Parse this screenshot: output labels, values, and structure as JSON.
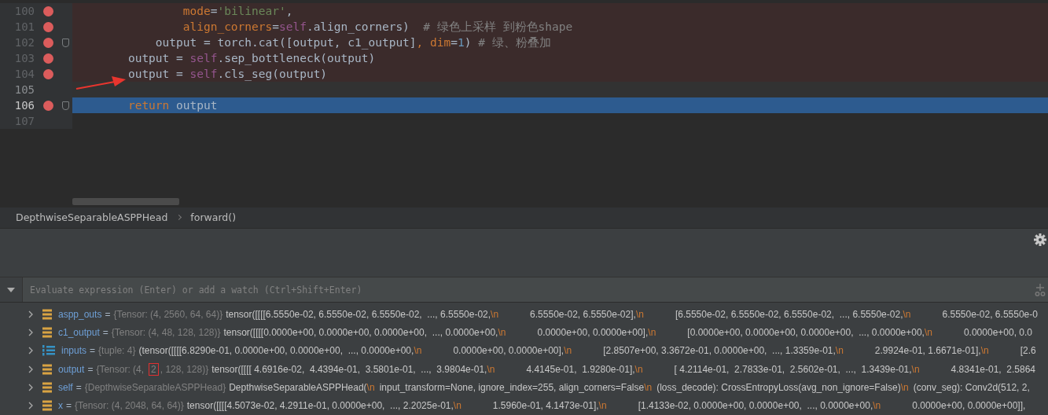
{
  "editor": {
    "lines": [
      {
        "number": "100",
        "breakpoint": true,
        "fold": false,
        "current": false,
        "caret": false,
        "tokens": [
          {
            "kind": "param",
            "text": "            mode"
          },
          {
            "kind": "plain",
            "text": "="
          },
          {
            "kind": "string",
            "text": "'bilinear'"
          },
          {
            "kind": "plain",
            "text": ","
          }
        ]
      },
      {
        "number": "101",
        "breakpoint": true,
        "fold": false,
        "current": false,
        "caret": false,
        "tokens": [
          {
            "kind": "param",
            "text": "            align_corners"
          },
          {
            "kind": "plain",
            "text": "="
          },
          {
            "kind": "self",
            "text": "self"
          },
          {
            "kind": "plain",
            "text": ".align_corners)  "
          },
          {
            "kind": "comment",
            "text": "# 绿色上采样 到粉色shape"
          }
        ]
      },
      {
        "number": "102",
        "breakpoint": true,
        "fold": true,
        "current": false,
        "caret": false,
        "tokens": [
          {
            "kind": "plain",
            "text": "        output = torch.cat([output, c1_output]"
          },
          {
            "kind": "keyword",
            "text": ", "
          },
          {
            "kind": "param",
            "text": "dim"
          },
          {
            "kind": "plain",
            "text": "="
          },
          {
            "kind": "number",
            "text": "1"
          },
          {
            "kind": "plain",
            "text": ") "
          },
          {
            "kind": "comment",
            "text": "# 绿、粉叠加"
          }
        ]
      },
      {
        "number": "103",
        "breakpoint": true,
        "fold": false,
        "current": false,
        "caret": false,
        "tokens": [
          {
            "kind": "plain",
            "text": "    output = "
          },
          {
            "kind": "self",
            "text": "self"
          },
          {
            "kind": "plain",
            "text": ".sep_bottleneck(output)"
          }
        ]
      },
      {
        "number": "104",
        "breakpoint": true,
        "fold": false,
        "current": false,
        "caret": false,
        "tokens": [
          {
            "kind": "plain",
            "text": "    output = "
          },
          {
            "kind": "self",
            "text": "self"
          },
          {
            "kind": "plain",
            "text": ".cls_seg(output)"
          }
        ]
      },
      {
        "number": "105",
        "breakpoint": false,
        "fold": false,
        "current": false,
        "caret": true
      },
      {
        "number": "106",
        "breakpoint": true,
        "fold": true,
        "current": true,
        "caret": false,
        "tokens": [
          {
            "kind": "keyword",
            "text": "    return"
          },
          {
            "kind": "plain",
            "text": " output"
          }
        ]
      },
      {
        "number": "107",
        "breakpoint": false,
        "fold": false,
        "current": false,
        "caret": false
      }
    ]
  },
  "breadcrumbs": [
    "DepthwiseSeparableASPPHead",
    "forward()"
  ],
  "watch": {
    "placeholder": "Evaluate expression (Enter) or add a watch (Ctrl+Shift+Enter)"
  },
  "variables": [
    {
      "kind": "tensor",
      "name": "aspp_outs",
      "equals": "=",
      "type": [
        {
          "text": "{Tensor: (4, 2560, 64, 64)}",
          "boxed": false
        }
      ],
      "parts": [
        {
          "kind": "value",
          "text": "tensor([[[[6.5550e-02, 6.5550e-02, 6.5550e-02,  ..., 6.5550e-02,"
        },
        {
          "kind": "escape",
          "text": "\\n"
        },
        {
          "kind": "value",
          "text": "6.5550e-02, 6.5550e-02],"
        },
        {
          "kind": "escape",
          "text": "\\n"
        },
        {
          "kind": "value",
          "text": "[6.5550e-02, 6.5550e-02, 6.5550e-02,  ..., 6.5550e-02,"
        },
        {
          "kind": "escape",
          "text": "\\n"
        },
        {
          "kind": "value",
          "text": "6.5550e-02, 6.5550e-0"
        }
      ]
    },
    {
      "kind": "tensor",
      "name": "c1_output",
      "equals": "=",
      "type": [
        {
          "text": "{Tensor: (4, 48, 128, 128)}",
          "boxed": false
        }
      ],
      "parts": [
        {
          "kind": "value",
          "text": "tensor([[[[0.0000e+00, 0.0000e+00, 0.0000e+00,  ..., 0.0000e+00,"
        },
        {
          "kind": "escape",
          "text": "\\n"
        },
        {
          "kind": "value",
          "text": "0.0000e+00, 0.0000e+00],"
        },
        {
          "kind": "escape",
          "text": "\\n"
        },
        {
          "kind": "value",
          "text": "[0.0000e+00, 0.0000e+00, 0.0000e+00,  ..., 0.0000e+00,"
        },
        {
          "kind": "escape",
          "text": "\\n"
        },
        {
          "kind": "value",
          "text": "0.0000e+00, 0.0"
        }
      ]
    },
    {
      "kind": "tuple",
      "name": "inputs",
      "equals": "=",
      "type": [
        {
          "text": "{tuple: 4}",
          "boxed": false
        }
      ],
      "parts": [
        {
          "kind": "value",
          "text": "(tensor([[[[6.8290e-01, 0.0000e+00, 0.0000e+00,  ..., 0.0000e+00,"
        },
        {
          "kind": "escape",
          "text": "\\n"
        },
        {
          "kind": "value",
          "text": "0.0000e+00, 0.0000e+00],"
        },
        {
          "kind": "escape",
          "text": "\\n"
        },
        {
          "kind": "value",
          "text": "[2.8507e+00, 3.3672e-01, 0.0000e+00,  ..., 1.3359e-01,"
        },
        {
          "kind": "escape",
          "text": "\\n"
        },
        {
          "kind": "value",
          "text": "2.9924e-01, 1.6671e-01],"
        },
        {
          "kind": "escape",
          "text": "\\n"
        },
        {
          "kind": "value",
          "text": "[2.6"
        }
      ]
    },
    {
      "kind": "tensor",
      "name": "output",
      "equals": "=",
      "type": [
        {
          "text": "{Tensor: (4,",
          "boxed": false
        },
        {
          "text": "2",
          "boxed": true
        },
        {
          "text": ", 128, 128)}",
          "boxed": false
        }
      ],
      "parts": [
        {
          "kind": "value",
          "text": "tensor([[[[ 4.6916e-02,  4.4394e-01,  3.5801e-01,  ...,  3.9804e-01,"
        },
        {
          "kind": "escape",
          "text": "\\n"
        },
        {
          "kind": "value",
          "text": "4.4145e-01,  1.9280e-01],"
        },
        {
          "kind": "escape",
          "text": "\\n"
        },
        {
          "kind": "value",
          "text": "[ 4.2114e-01,  2.7833e-01,  2.5602e-01,  ...,  1.3439e-01,"
        },
        {
          "kind": "escape",
          "text": "\\n"
        },
        {
          "kind": "value",
          "text": "4.8341e-01,  2.5864"
        }
      ]
    },
    {
      "kind": "object",
      "name": "self",
      "equals": "=",
      "type": [
        {
          "text": "{DepthwiseSeparableASPPHead}",
          "boxed": false
        }
      ],
      "parts": [
        {
          "kind": "value",
          "text": "DepthwiseSeparableASPPHead("
        },
        {
          "kind": "escape",
          "text": "\\n"
        },
        {
          "kind": "value",
          "text": "input_transform=None, ignore_index=255, align_corners=False"
        },
        {
          "kind": "escape",
          "text": "\\n"
        },
        {
          "kind": "value",
          "text": "(loss_decode): CrossEntropyLoss(avg_non_ignore=False)"
        },
        {
          "kind": "escape",
          "text": "\\n"
        },
        {
          "kind": "value",
          "text": "(conv_seg): Conv2d(512, 2,"
        }
      ]
    },
    {
      "kind": "tensor",
      "name": "x",
      "equals": "=",
      "type": [
        {
          "text": "{Tensor: (4, 2048, 64, 64)}",
          "boxed": false
        }
      ],
      "parts": [
        {
          "kind": "value",
          "text": "tensor([[[[4.5073e-02, 4.2911e-01, 0.0000e+00,  ..., 2.2025e-01,"
        },
        {
          "kind": "escape",
          "text": "\\n"
        },
        {
          "kind": "value",
          "text": "1.5960e-01, 4.1473e-01],"
        },
        {
          "kind": "escape",
          "text": "\\n"
        },
        {
          "kind": "value",
          "text": "[1.4133e-02, 0.0000e+00, 0.0000e+00,  ..., 0.0000e+00,"
        },
        {
          "kind": "escape",
          "text": "\\n"
        },
        {
          "kind": "value",
          "text": "0.0000e+00, 0.0000e+00]],"
        }
      ]
    }
  ]
}
